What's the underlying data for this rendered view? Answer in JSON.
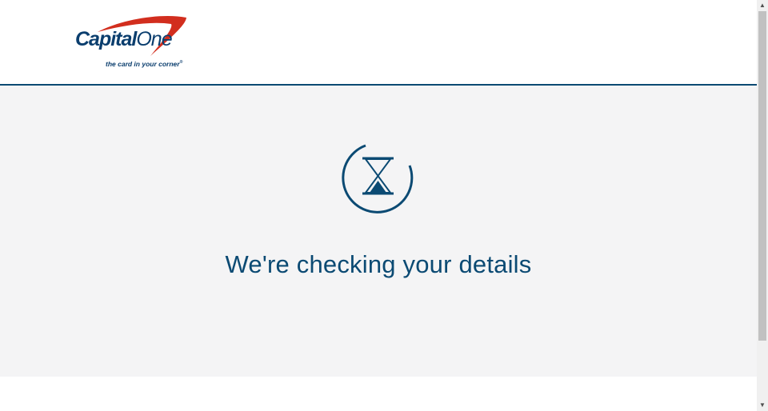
{
  "brand": {
    "wordmark_part1": "Capital",
    "wordmark_part2": "One",
    "tagline": "the card in your corner",
    "tagline_mark": "®",
    "primary_color": "#0b3e6e",
    "swoosh_color": "#d22e1e"
  },
  "status": {
    "icon": "hourglass-icon",
    "message": "We're checking your details",
    "text_color": "#0b4a73"
  },
  "colors": {
    "header_rule": "#0b4a73",
    "content_background": "#f4f4f5"
  },
  "scrollbar": {
    "up_glyph": "▲",
    "down_glyph": "▼"
  }
}
